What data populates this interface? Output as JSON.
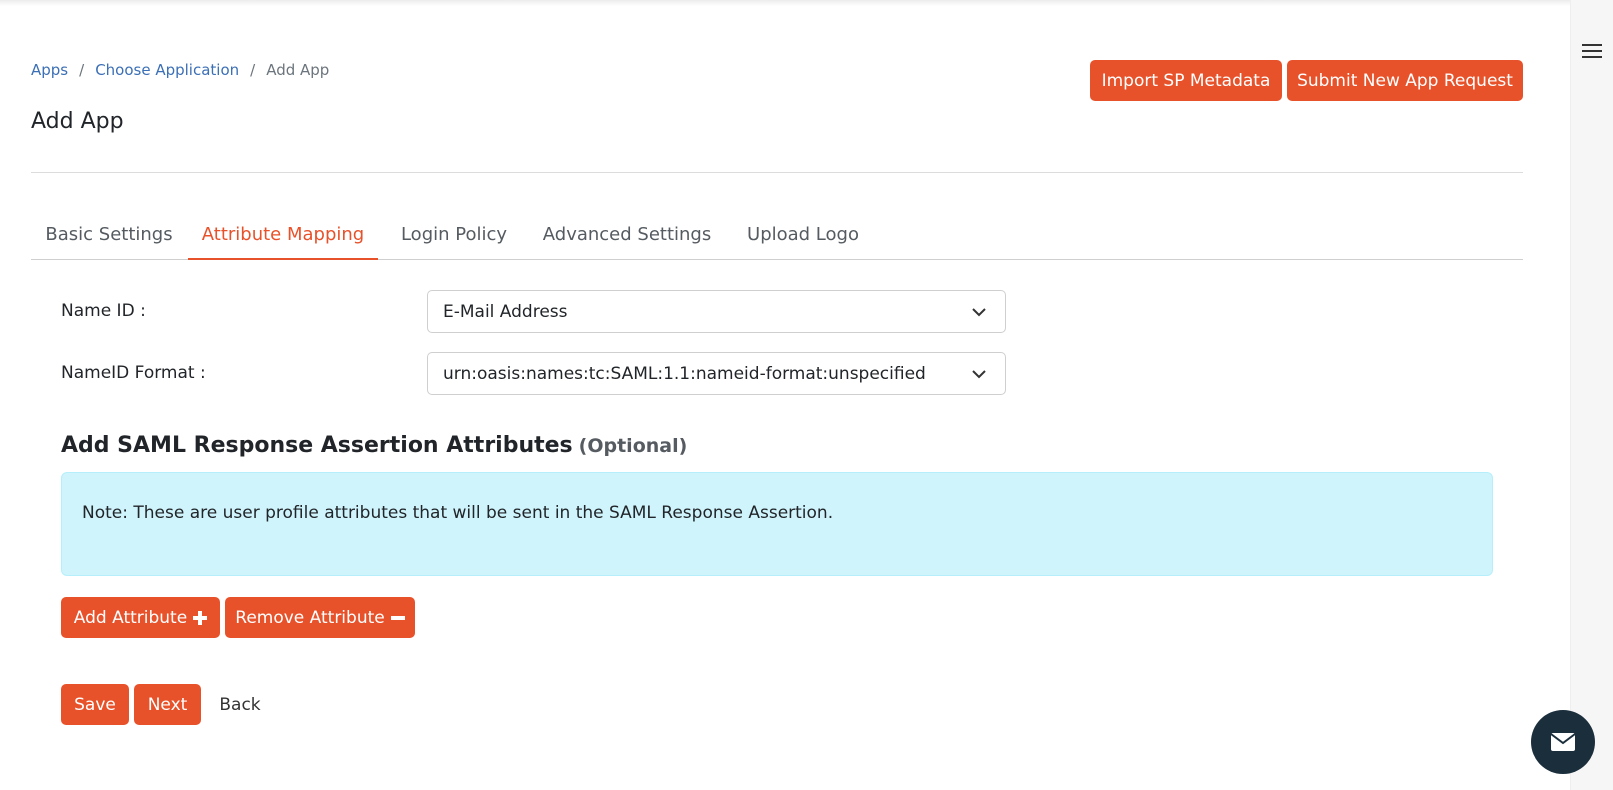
{
  "breadcrumb": {
    "items": [
      "Apps",
      "Choose Application",
      "Add App"
    ],
    "separator": "/"
  },
  "header": {
    "title": "Add App",
    "import_button": "Import SP Metadata",
    "submit_button": "Submit New App Request"
  },
  "tabs": [
    {
      "label": "Basic Settings",
      "active": false
    },
    {
      "label": "Attribute Mapping",
      "active": true
    },
    {
      "label": "Login Policy",
      "active": false
    },
    {
      "label": "Advanced Settings",
      "active": false
    },
    {
      "label": "Upload Logo",
      "active": false
    }
  ],
  "form": {
    "name_id_label": "Name ID :",
    "name_id_value": "E-Mail Address",
    "nameid_format_label": "NameID Format :",
    "nameid_format_value": "urn:oasis:names:tc:SAML:1.1:nameid-format:unspecified"
  },
  "attributes_section": {
    "title": "Add SAML Response Assertion Attributes",
    "optional": "(Optional)",
    "note": "Note: These are user profile attributes that will be sent in the SAML Response Assertion.",
    "add_button": "Add Attribute",
    "remove_button": "Remove Attribute"
  },
  "actions": {
    "save": "Save",
    "next": "Next",
    "back": "Back"
  },
  "colors": {
    "accent": "#e8522a",
    "link": "#3b6fb6",
    "note_bg": "#cff4fc",
    "fab_bg": "#1b2e3c"
  },
  "icons": [
    "hamburger-menu-icon",
    "chevron-down-icon",
    "plus-icon",
    "minus-icon",
    "mail-icon"
  ]
}
